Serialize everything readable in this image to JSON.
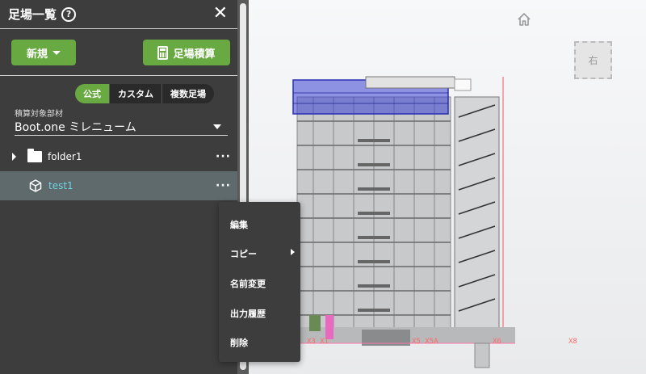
{
  "panel": {
    "title": "足場一覧",
    "help_glyph": "?",
    "close_glyph": "✕",
    "new_button": "新規",
    "calc_button": "足場積算",
    "tabs": [
      {
        "label": "公式",
        "active": true
      },
      {
        "label": "カスタム",
        "active": false
      },
      {
        "label": "複数足場",
        "active": false
      }
    ],
    "material_label": "積算対象部材",
    "material_value": "Boot.one ミレニューム",
    "tree": [
      {
        "label": "folder1",
        "type": "folder",
        "more": "···"
      },
      {
        "label": "test1",
        "type": "model",
        "more": "···",
        "selected": true
      }
    ]
  },
  "context_menu": {
    "items": [
      "編集",
      "コピー",
      "名前変更",
      "出力履歴",
      "削除"
    ]
  },
  "viewport": {
    "view_cube_label": "右",
    "cad_labels": [
      "X3 X1",
      "X5 X5A",
      "X6",
      "X8"
    ]
  },
  "colors": {
    "panel_bg": "#3d3d3d",
    "accent_green": "#68aa41",
    "selected_row": "#5e6a6c",
    "link_cyan": "#6fd3e2",
    "cad_red": "#ff6b6b",
    "selection_blue": "#3a3fd1"
  }
}
